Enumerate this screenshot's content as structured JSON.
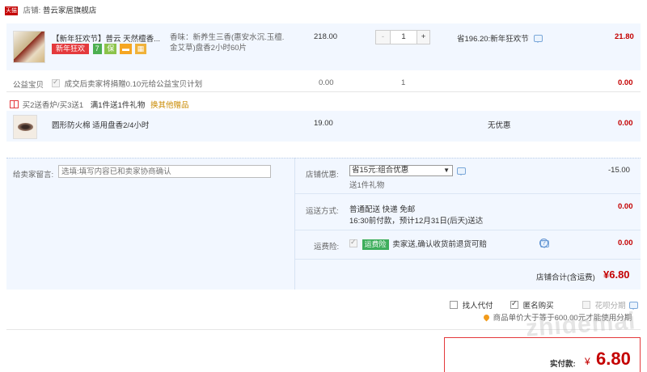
{
  "shop": {
    "badge": "天猫",
    "label": "店铺:",
    "name": "普云家居旗舰店"
  },
  "item1": {
    "title": "【新年狂欢节】普云 天然檀香...",
    "promo_tag": "新年狂欢",
    "icon_tags": [
      "7",
      "保",
      "▬",
      "▦"
    ],
    "sku": "香味：新养生三香(惠安水沉.玉檀.金艾草)盘香2小时60片",
    "price": "218.00",
    "qty_minus": "-",
    "qty": "1",
    "qty_plus": "+",
    "discount": "省196.20:新年狂欢节",
    "subtotal": "21.80"
  },
  "charity": {
    "label": "公益宝贝",
    "text": "成交后卖家将捐赠0.10元给公益宝贝计划",
    "price": "0.00",
    "qty": "1",
    "subtotal": "0.00"
  },
  "gift_promo": {
    "text": "买2送香炉/买3送1",
    "sub": "满1件送1件礼物",
    "link": "换其他赠品"
  },
  "item2": {
    "title": "圆形防火棉 适用盘香2/4小时",
    "price": "19.00",
    "discount": "无优惠",
    "subtotal": "0.00"
  },
  "message": {
    "label": "给卖家留言:",
    "placeholder": "选填:填写内容已和卖家协商确认"
  },
  "shop_discount": {
    "label": "店铺优惠:",
    "selected": "省15元:组合优惠",
    "note": "送1件礼物",
    "amount": "-15.00"
  },
  "shipping": {
    "label": "运送方式:",
    "method": "普通配送 快递 免邮",
    "eta": "16:30前付款，预计12月31日(后天)送达",
    "amount": "0.00"
  },
  "insurance": {
    "label": "运费险:",
    "tag": "运费险",
    "text": "卖家送,确认收货前退货可赔",
    "amount": "0.00"
  },
  "shop_total": {
    "label": "店铺合计(含运费)",
    "amount": "¥6.80"
  },
  "options": {
    "proxy_pay": "找人代付",
    "anonymous": "匿名购买",
    "huabei": "花呗分期"
  },
  "notice": "商品单价大于等于600.00元才能使用分期",
  "pay": {
    "label": "实付款:",
    "currency": "¥",
    "amount": "6.80"
  },
  "watermark": "zhidemai",
  "colors": {
    "accent": "#c40000",
    "tag_green": "#4caf50",
    "link_blue": "#3d6fb6"
  }
}
